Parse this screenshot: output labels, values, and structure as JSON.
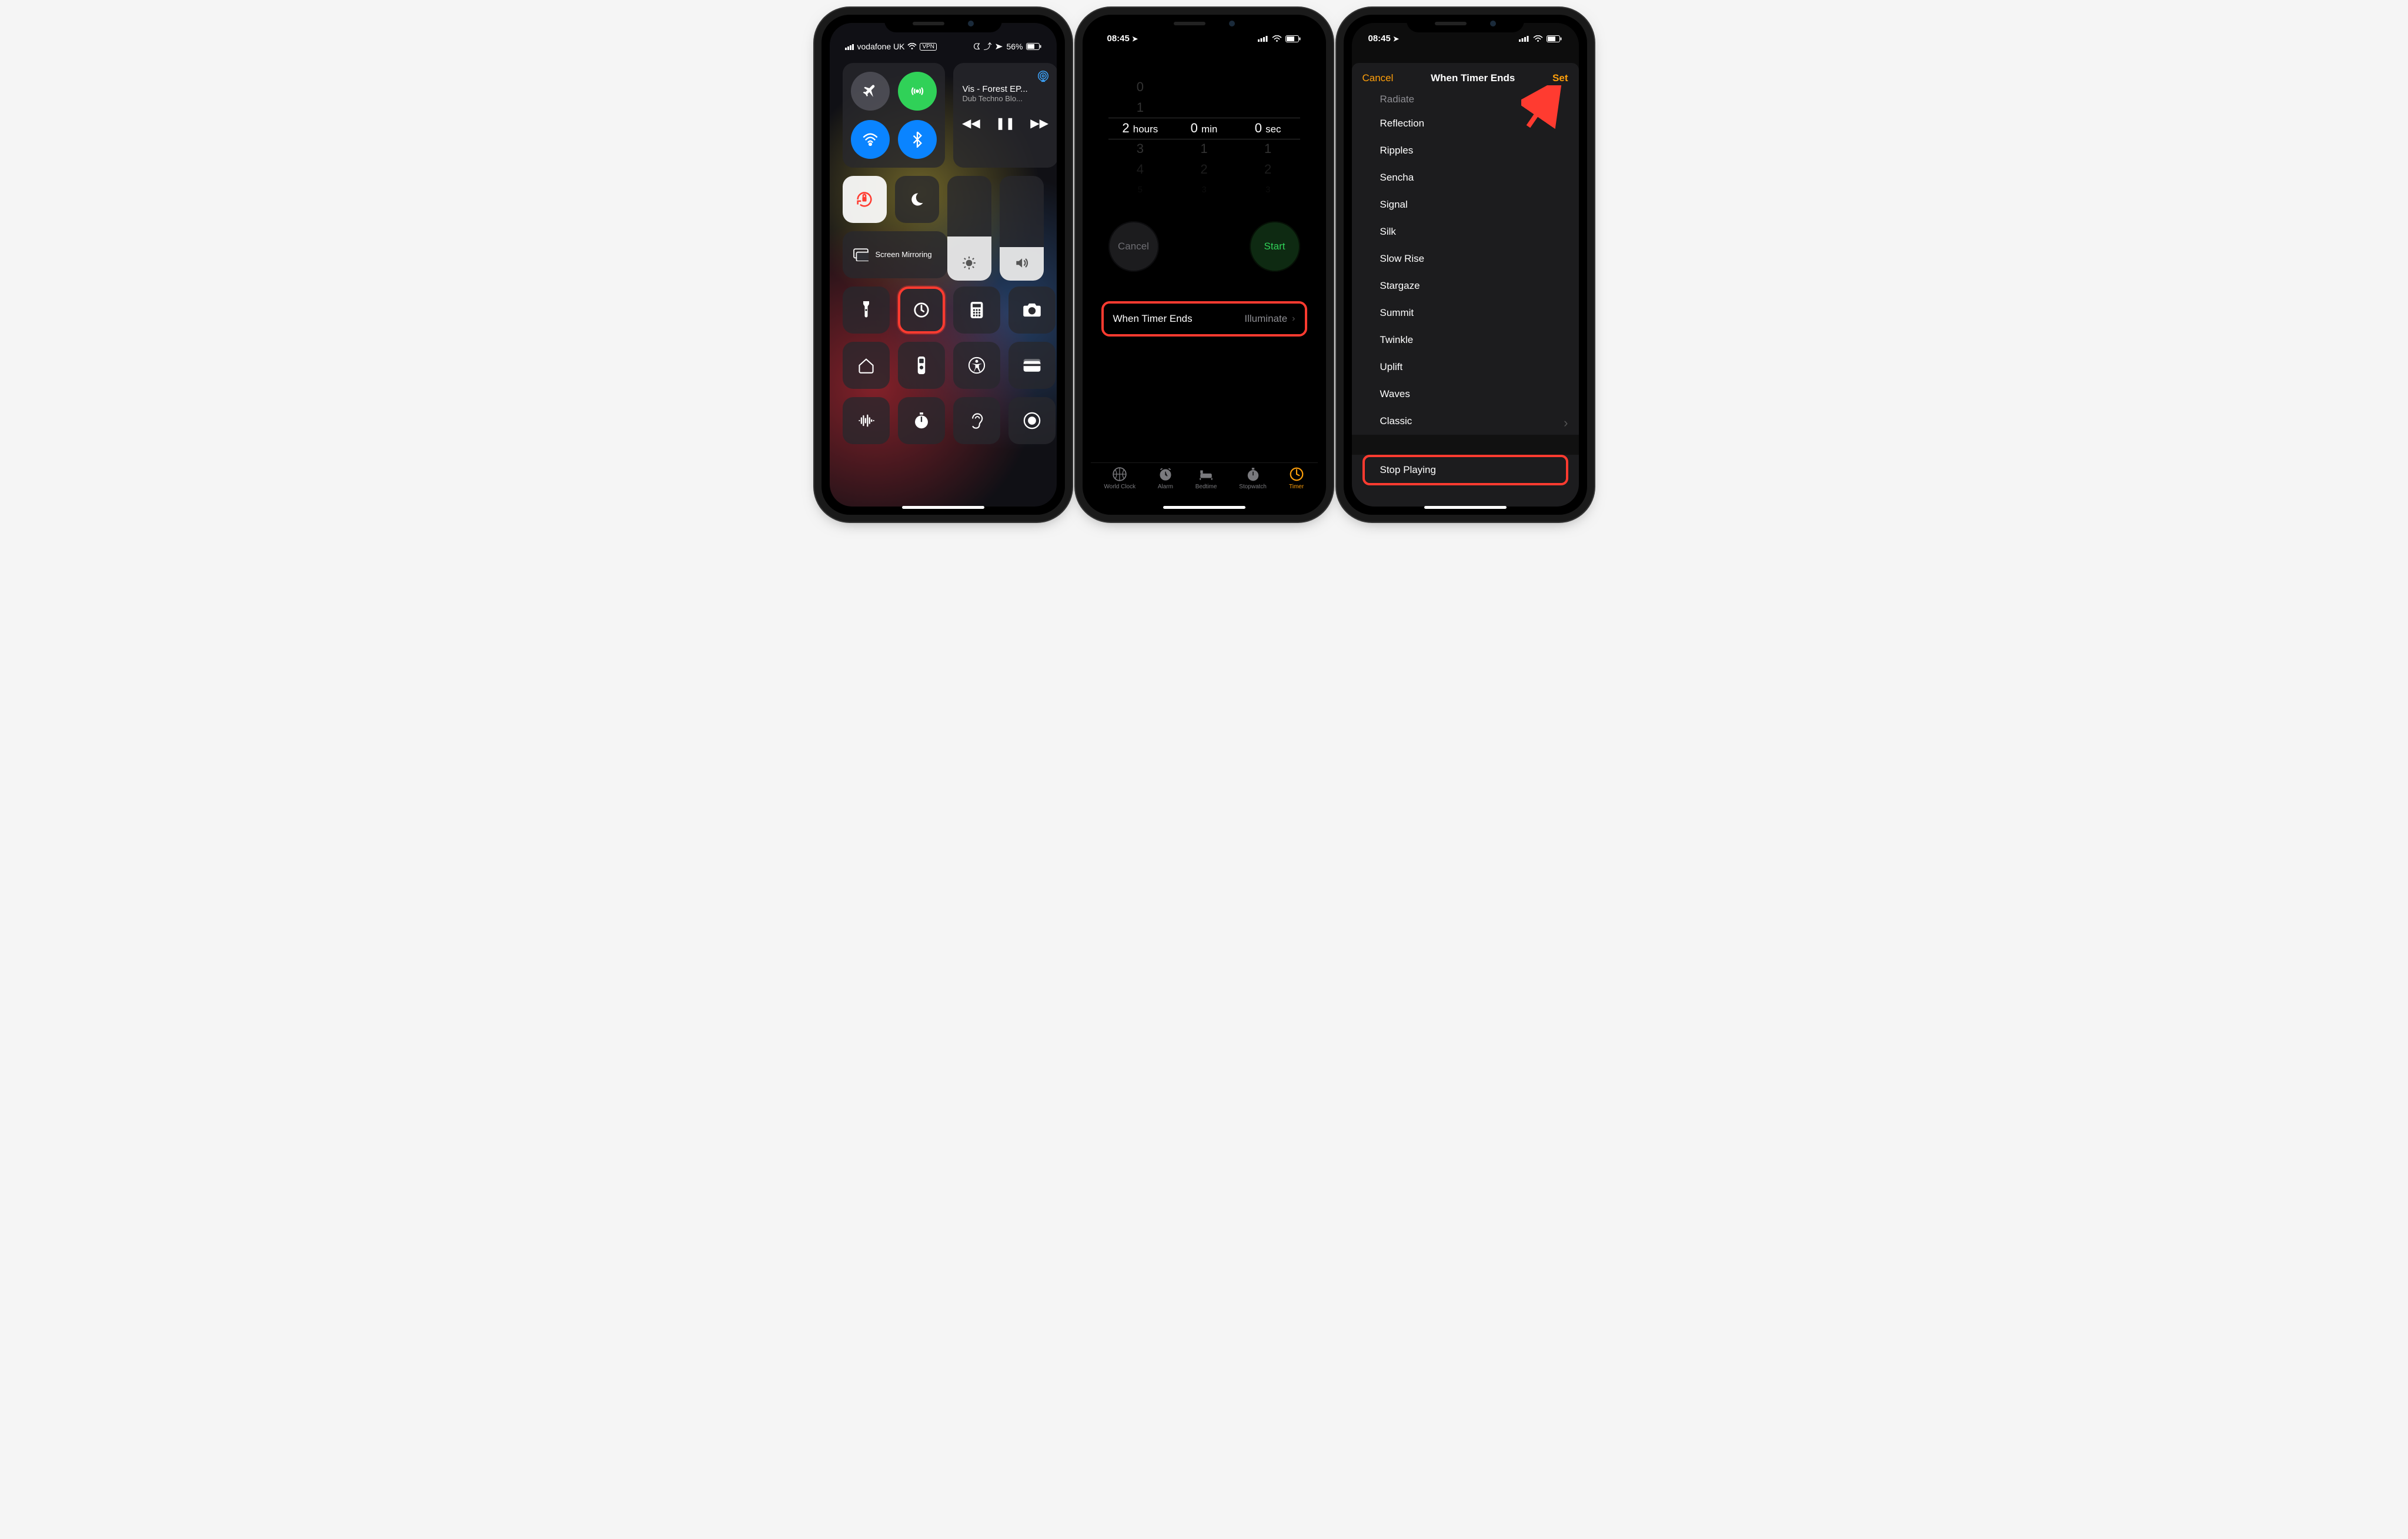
{
  "screen1": {
    "status": {
      "carrier": "vodafone UK",
      "vpn": "VPN",
      "batt": "56%",
      "icons": "ᗧ ↥ ↑ ⌖"
    },
    "media": {
      "title": "Vis - Forest EP...",
      "subtitle": "Dub Techno Blo..."
    },
    "mirror": "Screen Mirroring",
    "brightness_pct": 42,
    "volume_pct": 32
  },
  "screen2": {
    "time": "08:45",
    "picker": {
      "hours": [
        "0",
        "1",
        "2",
        "3",
        "4",
        "5"
      ],
      "h_lab": "hours",
      "mins": [
        "",
        "",
        "0",
        "1",
        "2",
        "3"
      ],
      "m_lab": "min",
      "secs": [
        "",
        "",
        "0",
        "1",
        "2",
        "3"
      ],
      "s_lab": "sec",
      "sel_h": "2",
      "sel_m": "0",
      "sel_s": "0"
    },
    "cancel": "Cancel",
    "start": "Start",
    "wte_label": "When Timer Ends",
    "wte_value": "Illuminate",
    "tabs": [
      "World Clock",
      "Alarm",
      "Bedtime",
      "Stopwatch",
      "Timer"
    ]
  },
  "screen3": {
    "time": "08:45",
    "cancel": "Cancel",
    "title": "When Timer Ends",
    "set": "Set",
    "tones": [
      "Radiate",
      "Reflection",
      "Ripples",
      "Sencha",
      "Signal",
      "Silk",
      "Slow Rise",
      "Stargaze",
      "Summit",
      "Twinkle",
      "Uplift",
      "Waves",
      "Classic"
    ],
    "stop": "Stop Playing"
  }
}
